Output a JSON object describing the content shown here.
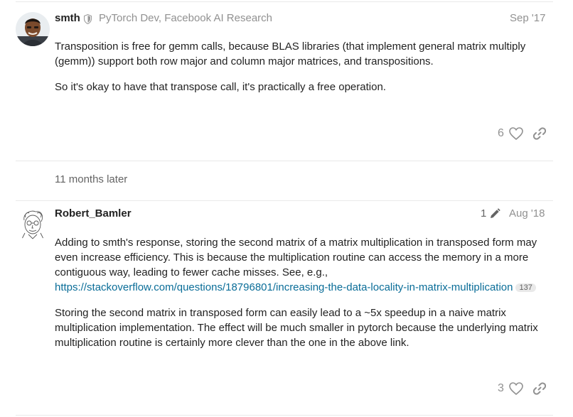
{
  "posts": [
    {
      "username": "smth",
      "user_title": "PyTorch Dev, Facebook AI Research",
      "date": "Sep '17",
      "paragraphs": [
        "Transposition is free for gemm calls, because BLAS libraries (that implement general matrix multiply (gemm)) support both row major and column major matrices, and transpositions.",
        "So it's okay to have that transpose call, it's practically a free operation."
      ],
      "like_count": "6"
    },
    {
      "username": "Robert_Bamler",
      "edit_count": "1",
      "date": "Aug '18",
      "paragraph1": "Adding to smth's response, storing the second matrix of a matrix multiplication in transposed form may even increase efficiency. This is because the multiplication routine can access the memory in a more contiguous way, leading to fewer cache misses. See, e.g.,",
      "link_text": "https://stackoverflow.com/questions/18796801/increasing-the-data-locality-in-matrix-multiplication",
      "link_clicks": "137",
      "paragraph2": "Storing the second matrix in transposed form can easily lead to a ~5x speedup in a naive matrix multiplication implementation. The effect will be much smaller in pytorch because the underlying matrix multiplication routine is certainly more clever than the one in the above link.",
      "like_count": "3"
    }
  ],
  "time_gap": "11 months later",
  "icons": {
    "moderator": "shield-icon",
    "like": "heart-icon",
    "share": "link-icon",
    "edit": "pencil-icon"
  },
  "colors": {
    "link": "#0a6d98",
    "muted": "#919191",
    "text": "#222222"
  }
}
